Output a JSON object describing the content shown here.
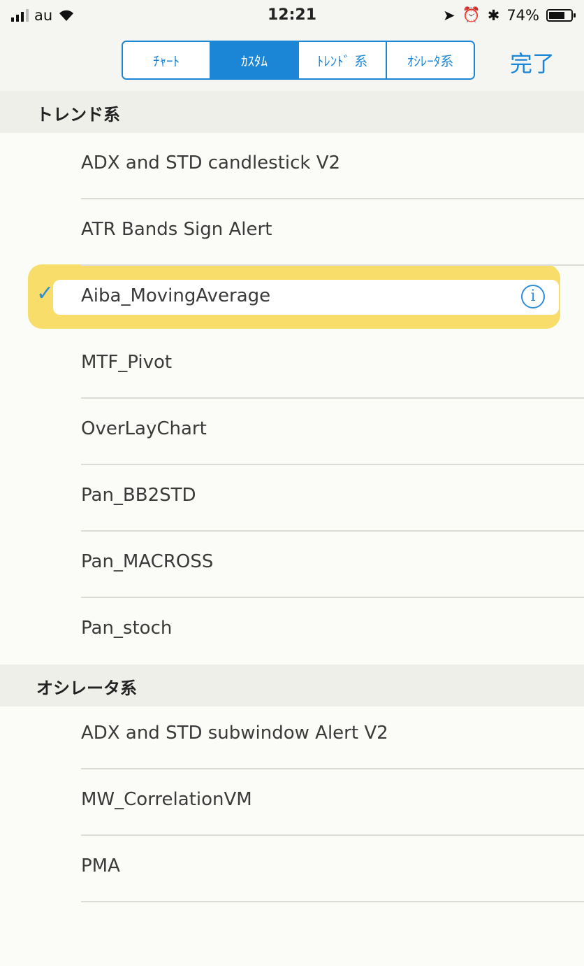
{
  "status_bar": {
    "carrier": "au",
    "time": "12:21",
    "battery": "74%",
    "battery_level": 0.74
  },
  "nav": {
    "tabs": [
      {
        "label": "ﾁｬｰﾄ",
        "active": false
      },
      {
        "label": "ｶｽﾀﾑ",
        "active": true
      },
      {
        "label": "ﾄﾚﾝﾄﾞ 系",
        "active": false
      },
      {
        "label": "ｵｼﾚｰﾀ系",
        "active": false
      }
    ],
    "done_label": "完了"
  },
  "sections": [
    {
      "title": "トレンド系",
      "items": [
        {
          "label": "ADX and STD candlestick V2",
          "checked": false
        },
        {
          "label": "ATR Bands Sign Alert",
          "checked": false
        },
        {
          "label": "Aiba_MovingAverage",
          "checked": true
        },
        {
          "label": "MTF_Pivot",
          "checked": false
        },
        {
          "label": "OverLayChart",
          "checked": false
        },
        {
          "label": "Pan_BB2STD",
          "checked": false
        },
        {
          "label": "Pan_MACROSS",
          "checked": false
        },
        {
          "label": "Pan_stoch",
          "checked": false
        }
      ]
    },
    {
      "title": "オシレータ系",
      "items": [
        {
          "label": "ADX and STD subwindow Alert V2",
          "checked": false
        },
        {
          "label": "MW_CorrelationVM",
          "checked": false
        },
        {
          "label": "PMA",
          "checked": false
        }
      ]
    }
  ],
  "icons": {
    "checkmark": "checkmark-icon",
    "info": "info-icon",
    "wifi": "wifi-icon",
    "signal": "signal-icon"
  },
  "colors": {
    "accent": "#1c86d6",
    "highlight": "#f8dd6a",
    "check": "#2f8fd8"
  }
}
